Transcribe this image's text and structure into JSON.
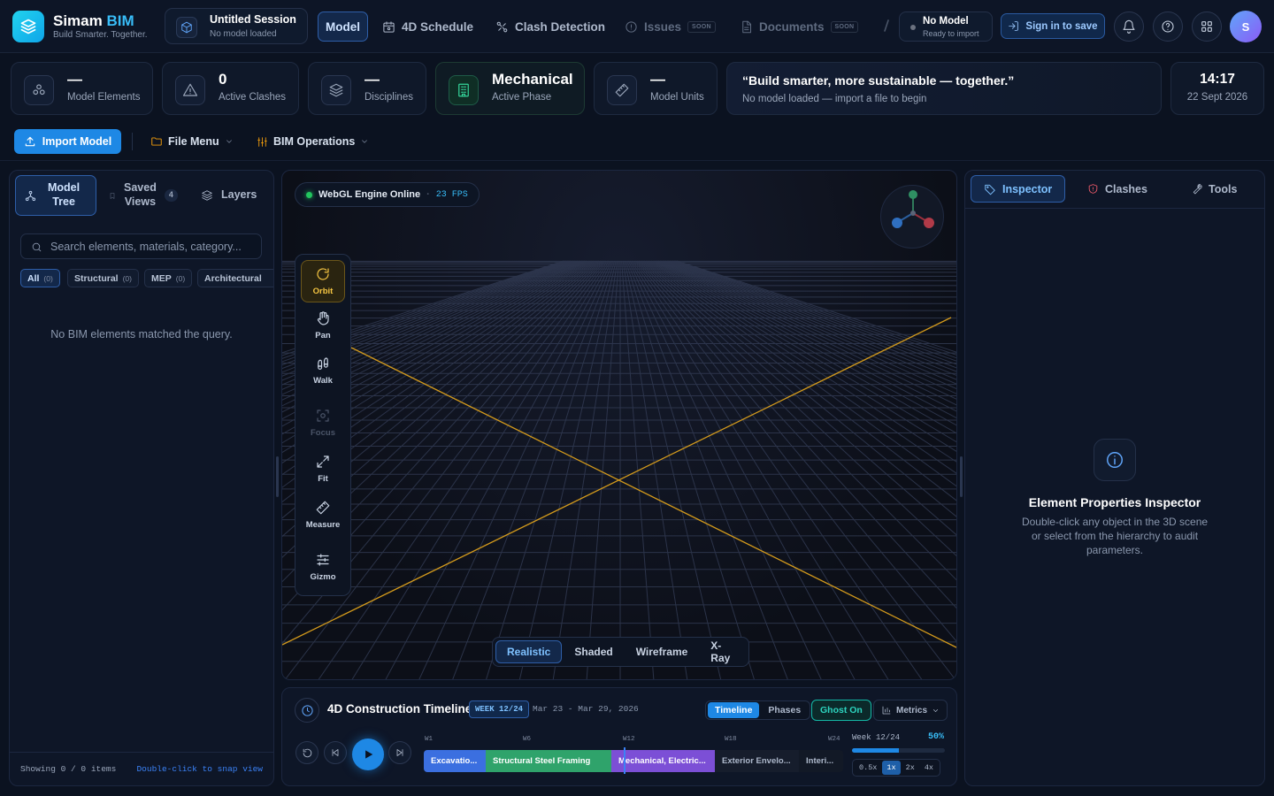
{
  "app": {
    "name": "Simam",
    "name_accent": "BIM",
    "tagline": "Build Smarter. Together."
  },
  "session": {
    "title": "Untitled Session",
    "subtitle": "No model loaded"
  },
  "nav": {
    "tabs": [
      {
        "label": "Model",
        "icon": "cube-icon",
        "active": true
      },
      {
        "label": "4D Schedule",
        "icon": "calendar-icon"
      },
      {
        "label": "Clash Detection",
        "icon": "clash-icon"
      },
      {
        "label": "Issues",
        "icon": "alert-circle-icon",
        "badge": "SOON"
      },
      {
        "label": "Documents",
        "icon": "document-icon",
        "badge": "SOON"
      }
    ]
  },
  "model_status": {
    "title": "No Model",
    "subtitle": "Ready to import"
  },
  "sign_in_label": "Sign in to save",
  "avatar_initial": "S",
  "stats": [
    {
      "value": "—",
      "label": "Model Elements",
      "icon": "components-icon"
    },
    {
      "value": "0",
      "label": "Active Clashes",
      "icon": "warning-icon"
    },
    {
      "value": "—",
      "label": "Disciplines",
      "icon": "layers-icon"
    },
    {
      "value": "Mechanical",
      "label": "Active Phase",
      "icon": "building-icon"
    },
    {
      "value": "—",
      "label": "Model Units",
      "icon": "ruler-icon"
    }
  ],
  "quote": {
    "text": "“Build smarter, more sustainable — together.”",
    "subtitle": "No model loaded — import a file to begin"
  },
  "clock": {
    "time": "14:17",
    "date": "22 Sept 2026"
  },
  "toolbar": {
    "import_label": "Import Model",
    "file_menu": "File Menu",
    "bim_ops": "BIM Operations"
  },
  "left_panel": {
    "tabs": [
      {
        "label_line1": "Model",
        "label_line2": "Tree",
        "icon": "hierarchy-icon",
        "active": true
      },
      {
        "label_line1": "Saved",
        "label_line2": "Views",
        "icon": "bookmark-icon",
        "count": "4"
      },
      {
        "label_line1": "Layers",
        "icon": "layers-icon"
      }
    ],
    "search_placeholder": "Search elements, materials, category...",
    "filters": [
      {
        "label": "All",
        "count": "(0)",
        "active": true
      },
      {
        "label": "Structural",
        "count": "(0)"
      },
      {
        "label": "MEP",
        "count": "(0)"
      },
      {
        "label": "Architectural",
        "count": ""
      }
    ],
    "empty_text": "No BIM elements matched the query.",
    "footer_count": "Showing 0 / 0 items",
    "footer_hint": "Double-click to snap view"
  },
  "viewport": {
    "engine_status": "WebGL Engine Online",
    "fps": "23 FPS",
    "tools": [
      {
        "label": "Orbit",
        "icon": "rotate-icon",
        "active": true
      },
      {
        "label": "Pan",
        "icon": "hand-icon"
      },
      {
        "label": "Walk",
        "icon": "footprints-icon"
      },
      {
        "label": "Focus",
        "icon": "focus-icon",
        "disabled": true
      },
      {
        "label": "Fit",
        "icon": "expand-icon"
      },
      {
        "label": "Measure",
        "icon": "ruler-icon"
      },
      {
        "label": "Gizmo",
        "icon": "sliders-icon"
      }
    ],
    "render_modes": [
      {
        "label": "Realistic",
        "active": true
      },
      {
        "label": "Shaded"
      },
      {
        "label": "Wireframe"
      },
      {
        "label": "X-Ray"
      }
    ]
  },
  "timeline": {
    "title": "4D Construction Timeline",
    "week_pill": "WEEK 12/24",
    "date_range": "Mar 23 - Mar 29, 2026",
    "view_toggle": [
      "Timeline",
      "Phases"
    ],
    "ghost_label": "Ghost On",
    "metrics_label": "Metrics",
    "week_markers": [
      "W1",
      "W6",
      "W12",
      "W18",
      "W24"
    ],
    "phases": [
      {
        "label": "Excavatio...",
        "color": "#3b6fe0"
      },
      {
        "label": "Structural Steel Framing",
        "color": "#2fa36b"
      },
      {
        "label": "Mechanical, Electric...",
        "color": "#7c4fd6"
      },
      {
        "label": "Exterior Envelo...",
        "color": "#161d2c"
      },
      {
        "label": "Interi...",
        "color": "#121926"
      }
    ],
    "week_status": "Week 12/24",
    "progress_label": "50%",
    "progress": 0.5,
    "speeds": [
      {
        "label": "0.5x"
      },
      {
        "label": "1x",
        "active": true
      },
      {
        "label": "2x"
      },
      {
        "label": "4x"
      }
    ]
  },
  "right_panel": {
    "tabs": [
      {
        "label": "Inspector",
        "icon": "tag-icon",
        "active": true
      },
      {
        "label": "Clashes",
        "icon": "shield-icon"
      },
      {
        "label": "Tools",
        "icon": "wrench-icon"
      }
    ],
    "empty_title": "Element Properties Inspector",
    "empty_desc": "Double-click any object in the 3D scene or select from the hierarchy to audit parameters."
  }
}
